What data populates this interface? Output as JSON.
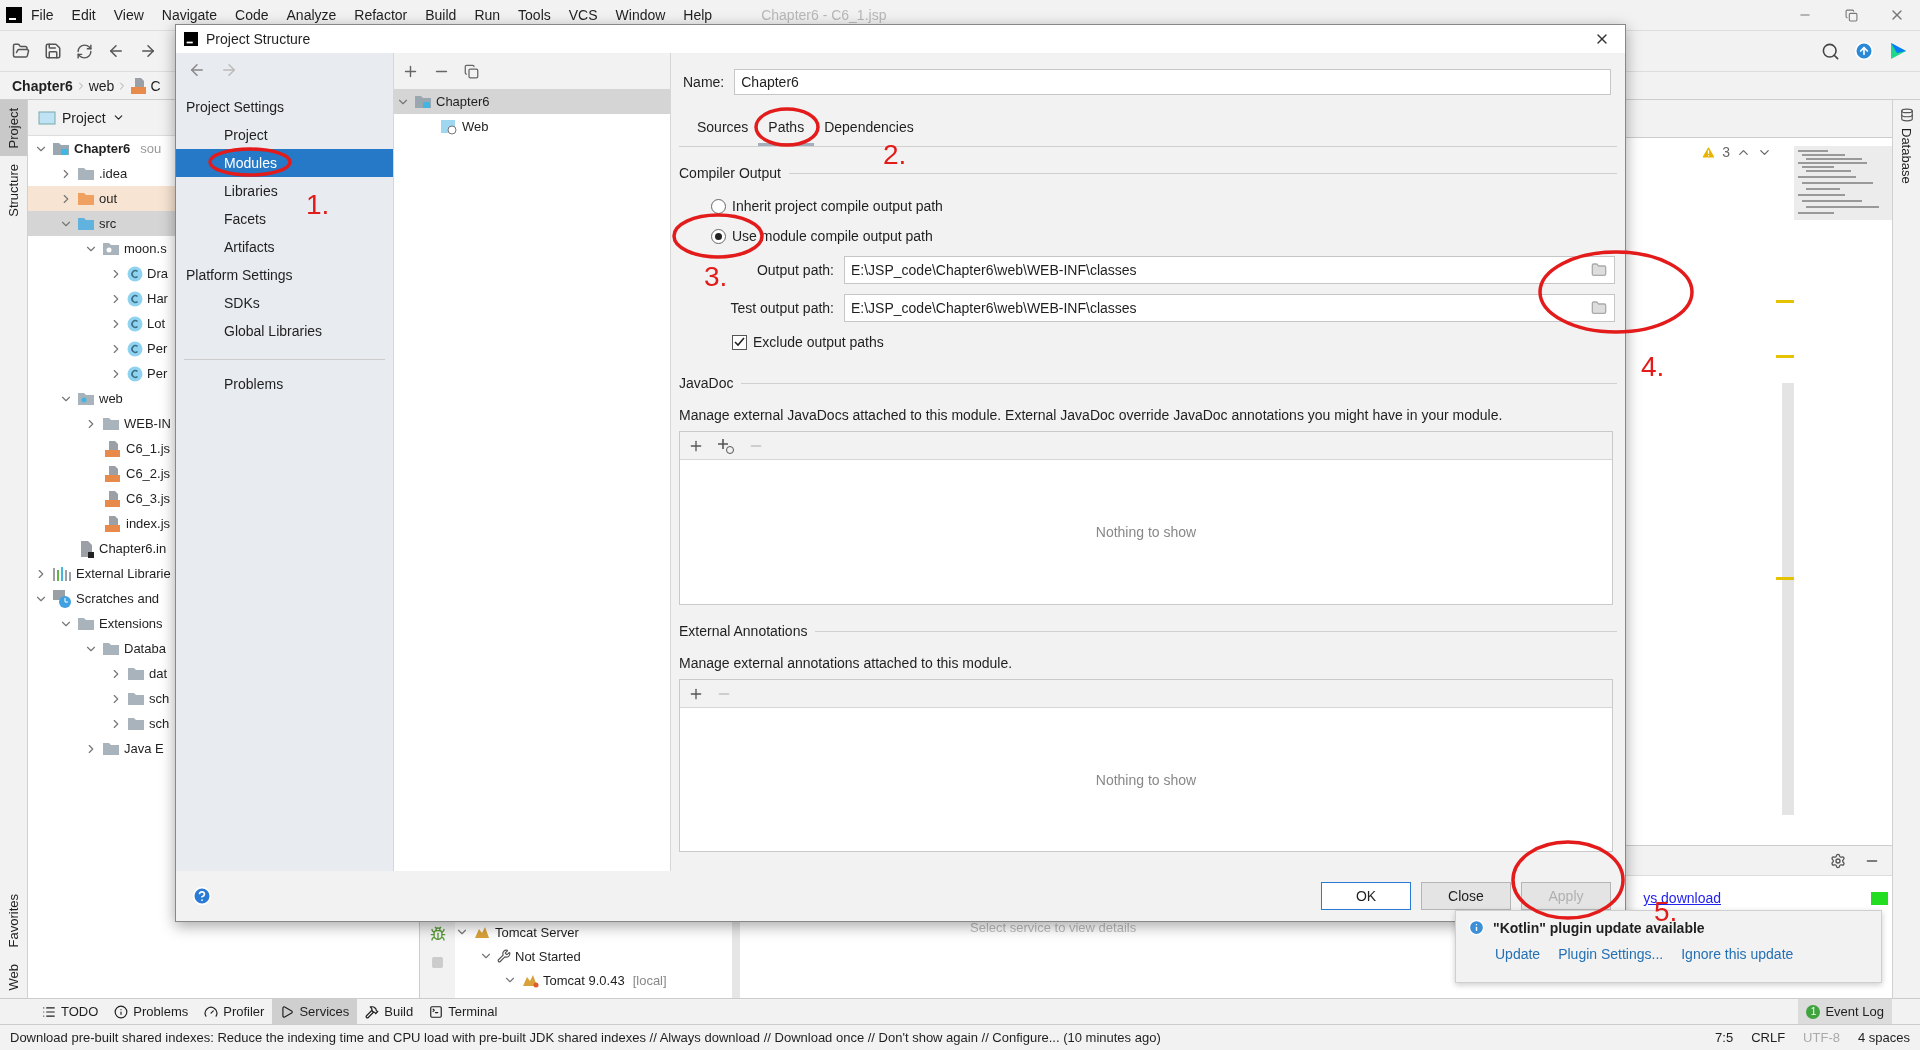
{
  "menu_bar": {
    "items": [
      "File",
      "Edit",
      "View",
      "Navigate",
      "Code",
      "Analyze",
      "Refactor",
      "Build",
      "Run",
      "Tools",
      "VCS",
      "Window",
      "Help"
    ],
    "title": "Chapter6 - C6_1.jsp"
  },
  "breadcrumbs": [
    {
      "label": "Chapter6",
      "kind": "project"
    },
    {
      "label": "web",
      "kind": "folder"
    },
    {
      "label": "C",
      "kind": "jsp"
    }
  ],
  "left_tool_strip": {
    "top": [
      {
        "label": "Project",
        "selected": true
      },
      {
        "label": "Structure",
        "selected": false
      }
    ],
    "bottom": [
      {
        "label": "Favorites",
        "selected": false
      },
      {
        "label": "Web",
        "selected": false
      }
    ]
  },
  "project_panel": {
    "title": "Project",
    "tree": [
      {
        "label": "Chapter6",
        "suffix": "sou",
        "kind": "module",
        "expanded": true,
        "selected": false,
        "children": [
          {
            "label": ".idea",
            "kind": "folder",
            "expanded": false,
            "selected": false
          },
          {
            "label": "out",
            "kind": "excluded",
            "expanded": false,
            "selected": false
          },
          {
            "label": "src",
            "kind": "source",
            "expanded": true,
            "selected": true,
            "children": [
              {
                "label": "moon.s",
                "kind": "package",
                "expanded": true,
                "selected": false,
                "children": [
                  {
                    "label": "Dra",
                    "kind": "class",
                    "expanded": false,
                    "selected": false
                  },
                  {
                    "label": "Har",
                    "kind": "class",
                    "expanded": false,
                    "selected": false
                  },
                  {
                    "label": "Lot",
                    "kind": "class",
                    "expanded": false,
                    "selected": false
                  },
                  {
                    "label": "Per",
                    "kind": "class",
                    "expanded": false,
                    "selected": false
                  },
                  {
                    "label": "Per",
                    "kind": "class",
                    "expanded": false,
                    "selected": false
                  }
                ]
              }
            ]
          },
          {
            "label": "web",
            "kind": "web",
            "expanded": true,
            "selected": false,
            "children": [
              {
                "label": "WEB-IN",
                "kind": "folder",
                "expanded": false,
                "selected": false
              },
              {
                "label": "C6_1.js",
                "kind": "jsp",
                "selected": false
              },
              {
                "label": "C6_2.js",
                "kind": "jsp",
                "selected": false
              },
              {
                "label": "C6_3.js",
                "kind": "jsp",
                "selected": false
              },
              {
                "label": "index.js",
                "kind": "jsp",
                "selected": false
              }
            ]
          },
          {
            "label": "Chapter6.in",
            "kind": "iml",
            "selected": false
          }
        ]
      },
      {
        "label": "External Librarie",
        "kind": "library",
        "expanded": false,
        "selected": false
      },
      {
        "label": "Scratches and",
        "kind": "scratches",
        "expanded": true,
        "selected": false,
        "children": [
          {
            "label": "Extensions",
            "kind": "folder",
            "expanded": true,
            "selected": false,
            "children": [
              {
                "label": "Databa",
                "kind": "folder",
                "expanded": true,
                "selected": false,
                "children": [
                  {
                    "label": "dat",
                    "kind": "folder",
                    "expanded": false,
                    "selected": false
                  },
                  {
                    "label": "sch",
                    "kind": "folder",
                    "expanded": false,
                    "selected": false
                  },
                  {
                    "label": "sch",
                    "kind": "folder",
                    "expanded": false,
                    "selected": false
                  }
                ]
              },
              {
                "label": "Java E",
                "kind": "folder",
                "expanded": false,
                "selected": false
              }
            ]
          }
        ]
      }
    ]
  },
  "editor": {
    "warning_count": "3"
  },
  "right_tool_strip": [
    {
      "label": "Database",
      "selected": false
    }
  ],
  "services": {
    "tree": [
      {
        "label": "Tomcat Server",
        "kind": "server",
        "expanded": true,
        "children": [
          {
            "label": "Not Started",
            "kind": "status",
            "expanded": true,
            "children": [
              {
                "label": "Tomcat 9.0.43",
                "tag": "[local]",
                "kind": "tomcat",
                "expanded": true
              }
            ]
          }
        ]
      }
    ],
    "hint": "Select service to view details",
    "link": "ys download"
  },
  "dialog": {
    "title": "Project Structure",
    "nav_sections": [
      {
        "heading": "Project Settings",
        "items": [
          {
            "label": "Project",
            "selected": false
          },
          {
            "label": "Modules",
            "selected": true
          },
          {
            "label": "Libraries",
            "selected": false
          },
          {
            "label": "Facets",
            "selected": false
          },
          {
            "label": "Artifacts",
            "selected": false
          }
        ]
      },
      {
        "heading": "Platform Settings",
        "items": [
          {
            "label": "SDKs",
            "selected": false
          },
          {
            "label": "Global Libraries",
            "selected": false
          }
        ]
      },
      {
        "items": [
          {
            "label": "Problems",
            "selected": false
          }
        ]
      }
    ],
    "module_tree": [
      {
        "label": "Chapter6",
        "kind": "module",
        "expanded": true,
        "selected": true,
        "children": [
          {
            "label": "Web",
            "kind": "web-facet",
            "selected": false
          }
        ]
      }
    ],
    "name_label": "Name:",
    "name_value": "Chapter6",
    "tabs": [
      {
        "label": "Sources",
        "selected": false
      },
      {
        "label": "Paths",
        "selected": true
      },
      {
        "label": "Dependencies",
        "selected": false
      }
    ],
    "compiler_output": {
      "heading": "Compiler Output",
      "options": [
        {
          "label": "Inherit project compile output path",
          "selected": false
        },
        {
          "label": "Use module compile output path",
          "selected": true
        }
      ],
      "fields": [
        {
          "label": "Output path:",
          "value": "E:\\JSP_code\\Chapter6\\web\\WEB-INF\\classes"
        },
        {
          "label": "Test output path:",
          "value": "E:\\JSP_code\\Chapter6\\web\\WEB-INF\\classes"
        }
      ],
      "exclude": {
        "label": "Exclude output paths",
        "checked": true
      }
    },
    "javadoc": {
      "heading": "JavaDoc",
      "description": "Manage external JavaDocs attached to this module. External JavaDoc override JavaDoc annotations you might have in your module.",
      "empty_text": "Nothing to show",
      "tools": [
        {
          "kind": "add",
          "disabled": false
        },
        {
          "kind": "add-url",
          "disabled": false
        },
        {
          "kind": "remove",
          "disabled": true
        }
      ]
    },
    "external_annotations": {
      "heading": "External Annotations",
      "description": "Manage external annotations attached to this module.",
      "empty_text": "Nothing to show",
      "tools": [
        {
          "kind": "add",
          "disabled": false
        },
        {
          "kind": "remove",
          "disabled": true
        }
      ]
    },
    "buttons": [
      {
        "label": "OK",
        "kind": "default",
        "disabled": false
      },
      {
        "label": "Close",
        "kind": "normal",
        "disabled": false
      },
      {
        "label": "Apply",
        "kind": "normal",
        "disabled": true
      }
    ]
  },
  "notification": {
    "title": "\"Kotlin\" plugin update available",
    "actions": [
      "Update",
      "Plugin Settings...",
      "Ignore this update"
    ]
  },
  "tool_window_bar": {
    "items": [
      {
        "label": "TODO",
        "kind": "todo",
        "selected": false
      },
      {
        "label": "Problems",
        "kind": "problems",
        "selected": false
      },
      {
        "label": "Profiler",
        "kind": "profiler",
        "selected": false
      },
      {
        "label": "Services",
        "kind": "services",
        "selected": true
      },
      {
        "label": "Build",
        "kind": "build",
        "selected": false
      },
      {
        "label": "Terminal",
        "kind": "terminal",
        "selected": false
      }
    ],
    "event_log": {
      "label": "Event Log",
      "badge": "1"
    }
  },
  "status_bar": {
    "message": "Download pre-built shared indexes: Reduce the indexing time and CPU load with pre-built JDK shared indexes // Always download // Download once // Don't show again // Configure... (10 minutes ago)",
    "position": "7:5",
    "line_ending": "CRLF",
    "encoding": "UTF-8",
    "indent": "4 spaces"
  },
  "annotations": [
    {
      "label": "1."
    },
    {
      "label": "2."
    },
    {
      "label": "3."
    },
    {
      "label": "4."
    },
    {
      "label": "5."
    }
  ]
}
